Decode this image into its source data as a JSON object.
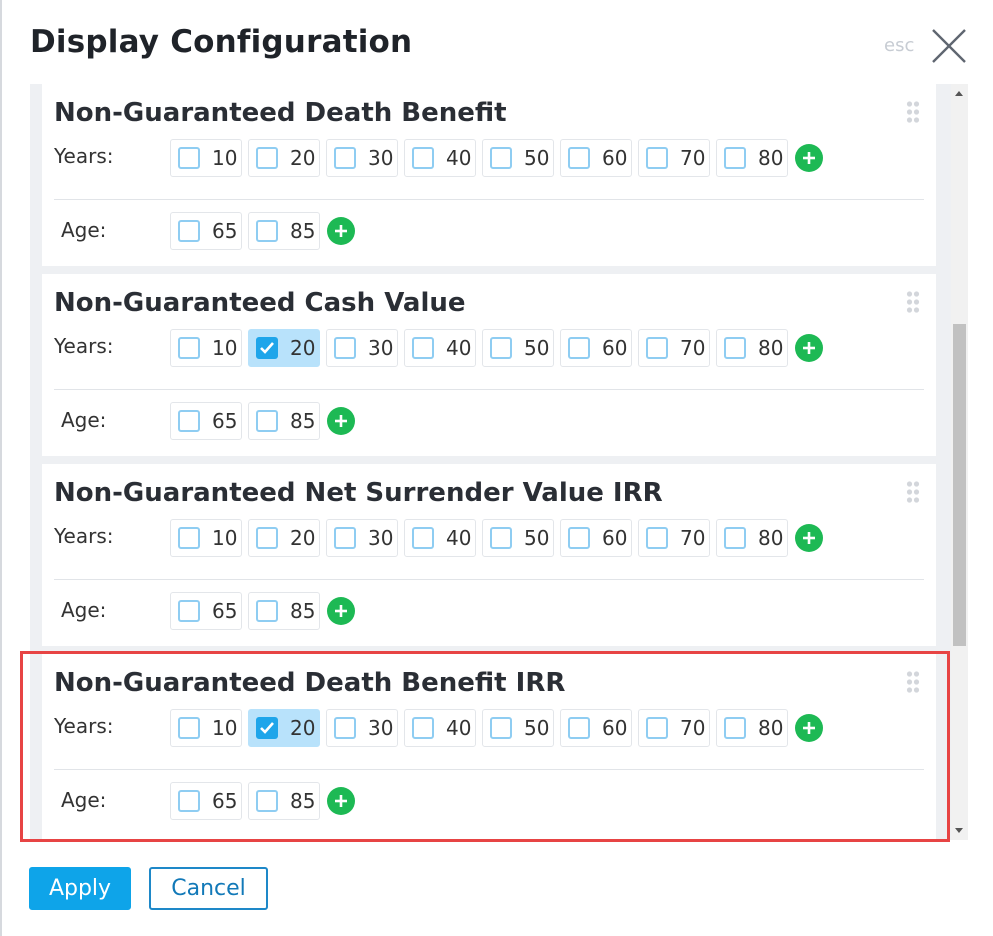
{
  "dialog": {
    "title": "Display Configuration",
    "esc_label": "esc"
  },
  "sections": [
    {
      "title": "Non-Guaranteed Death Benefit",
      "years_label": "Years:",
      "age_label": "Age:",
      "years": [
        {
          "label": "10",
          "checked": false
        },
        {
          "label": "20",
          "checked": false
        },
        {
          "label": "30",
          "checked": false
        },
        {
          "label": "40",
          "checked": false
        },
        {
          "label": "50",
          "checked": false
        },
        {
          "label": "60",
          "checked": false
        },
        {
          "label": "70",
          "checked": false
        },
        {
          "label": "80",
          "checked": false
        }
      ],
      "ages": [
        {
          "label": "65",
          "checked": false
        },
        {
          "label": "85",
          "checked": false
        }
      ]
    },
    {
      "title": "Non-Guaranteed Cash Value",
      "years_label": "Years:",
      "age_label": "Age:",
      "years": [
        {
          "label": "10",
          "checked": false
        },
        {
          "label": "20",
          "checked": true
        },
        {
          "label": "30",
          "checked": false
        },
        {
          "label": "40",
          "checked": false
        },
        {
          "label": "50",
          "checked": false
        },
        {
          "label": "60",
          "checked": false
        },
        {
          "label": "70",
          "checked": false
        },
        {
          "label": "80",
          "checked": false
        }
      ],
      "ages": [
        {
          "label": "65",
          "checked": false
        },
        {
          "label": "85",
          "checked": false
        }
      ]
    },
    {
      "title": "Non-Guaranteed Net Surrender Value IRR",
      "years_label": "Years:",
      "age_label": "Age:",
      "years": [
        {
          "label": "10",
          "checked": false
        },
        {
          "label": "20",
          "checked": false
        },
        {
          "label": "30",
          "checked": false
        },
        {
          "label": "40",
          "checked": false
        },
        {
          "label": "50",
          "checked": false
        },
        {
          "label": "60",
          "checked": false
        },
        {
          "label": "70",
          "checked": false
        },
        {
          "label": "80",
          "checked": false
        }
      ],
      "ages": [
        {
          "label": "65",
          "checked": false
        },
        {
          "label": "85",
          "checked": false
        }
      ]
    },
    {
      "title": "Non-Guaranteed Death Benefit IRR",
      "years_label": "Years:",
      "age_label": "Age:",
      "years": [
        {
          "label": "10",
          "checked": false
        },
        {
          "label": "20",
          "checked": true
        },
        {
          "label": "30",
          "checked": false
        },
        {
          "label": "40",
          "checked": false
        },
        {
          "label": "50",
          "checked": false
        },
        {
          "label": "60",
          "checked": false
        },
        {
          "label": "70",
          "checked": false
        },
        {
          "label": "80",
          "checked": false
        }
      ],
      "ages": [
        {
          "label": "65",
          "checked": false
        },
        {
          "label": "85",
          "checked": false
        }
      ]
    }
  ],
  "footer": {
    "apply_label": "Apply",
    "cancel_label": "Cancel"
  },
  "colors": {
    "accent": "#0ea4e9",
    "checked_chip_bg": "#b8e2fb",
    "add_button": "#1db954",
    "highlight_border": "#e74444"
  },
  "icons": {
    "close": "close-icon",
    "add": "plus-icon",
    "drag": "drag-handle-icon",
    "check": "checkmark-icon"
  }
}
